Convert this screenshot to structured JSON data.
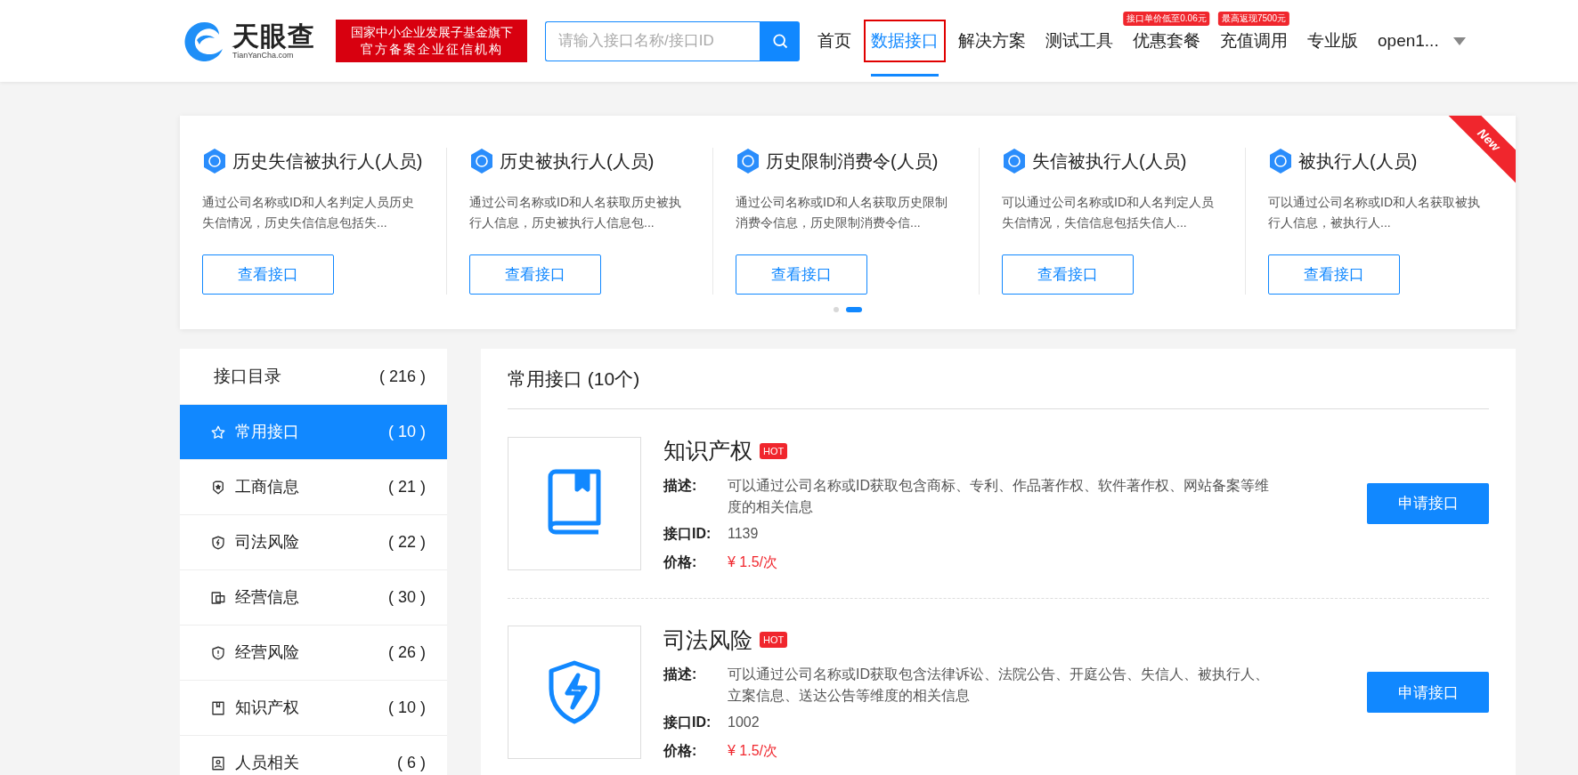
{
  "header": {
    "logo": {
      "name": "天眼查",
      "domain": "TianYanCha.com"
    },
    "slogan": [
      "国家中小企业发展子基金旗下",
      "官方备案企业征信机构"
    ],
    "search": {
      "placeholder": "请输入接口名称/接口ID"
    },
    "nav": [
      {
        "label": "首页",
        "selected": false
      },
      {
        "label": "数据接口",
        "selected": true
      },
      {
        "label": "解决方案",
        "selected": false
      },
      {
        "label": "测试工具",
        "selected": false
      },
      {
        "label": "优惠套餐",
        "selected": false,
        "badge": "接口单价低至0.06元"
      },
      {
        "label": "充值调用",
        "selected": false,
        "badge": "最高返现7500元"
      },
      {
        "label": "专业版",
        "selected": false
      }
    ],
    "user": "open1..."
  },
  "carousel": {
    "ribbon": "New",
    "cards": [
      {
        "title": "历史失信被执行人(人员)",
        "description": "通过公司名称或ID和人名判定人员历史失信情况，历史失信信息包括失...",
        "button": "查看接口"
      },
      {
        "title": "历史被执行人(人员)",
        "description": "通过公司名称或ID和人名获取历史被执行人信息，历史被执行人信息包...",
        "button": "查看接口"
      },
      {
        "title": "历史限制消费令(人员)",
        "description": "通过公司名称或ID和人名获取历史限制消费令信息，历史限制消费令信...",
        "button": "查看接口"
      },
      {
        "title": "失信被执行人(人员)",
        "description": "可以通过公司名称或ID和人名判定人员失信情况，失信信息包括失信人...",
        "button": "查看接口"
      },
      {
        "title": "被执行人(人员)",
        "description": "可以通过公司名称或ID和人名获取被执行人信息，被执行人...",
        "button": "查看接口"
      }
    ],
    "dots": [
      {
        "selected": false
      },
      {
        "selected": true
      }
    ]
  },
  "sidebar": {
    "title": "接口目录",
    "count": "( 216 )",
    "items": [
      {
        "label": "常用接口",
        "count": "( 10 )",
        "kind": "star",
        "selected": true
      },
      {
        "label": "工商信息",
        "count": "( 21 )",
        "kind": "badge",
        "selected": false
      },
      {
        "label": "司法风险",
        "count": "( 22 )",
        "kind": "shield",
        "selected": false
      },
      {
        "label": "经营信息",
        "count": "( 30 )",
        "kind": "monitor",
        "selected": false
      },
      {
        "label": "经营风险",
        "count": "( 26 )",
        "kind": "alert",
        "selected": false
      },
      {
        "label": "知识产权",
        "count": "( 10 )",
        "kind": "book",
        "selected": false
      },
      {
        "label": "人员相关",
        "count": "( 6 )",
        "kind": "person",
        "selected": false
      }
    ]
  },
  "main": {
    "title": "常用接口 (10个)",
    "apis": [
      {
        "name": "知识产权",
        "tag": "HOT",
        "kind": "book",
        "desc_label": "描述:",
        "description": "可以通过公司名称或ID获取包含商标、专利、作品著作权、软件著作权、网站备案等维度的相关信息",
        "id_label": "接口ID:",
        "id": "1139",
        "price_label": "价格:",
        "price": "¥ 1.5/次",
        "button": "申请接口"
      },
      {
        "name": "司法风险",
        "tag": "HOT",
        "kind": "shield",
        "desc_label": "描述:",
        "description": "可以通过公司名称或ID获取包含法律诉讼、法院公告、开庭公告、失信人、被执行人、立案信息、送达公告等维度的相关信息",
        "id_label": "接口ID:",
        "id": "1002",
        "price_label": "价格:",
        "price": "¥ 1.5/次",
        "button": "申请接口"
      }
    ]
  }
}
